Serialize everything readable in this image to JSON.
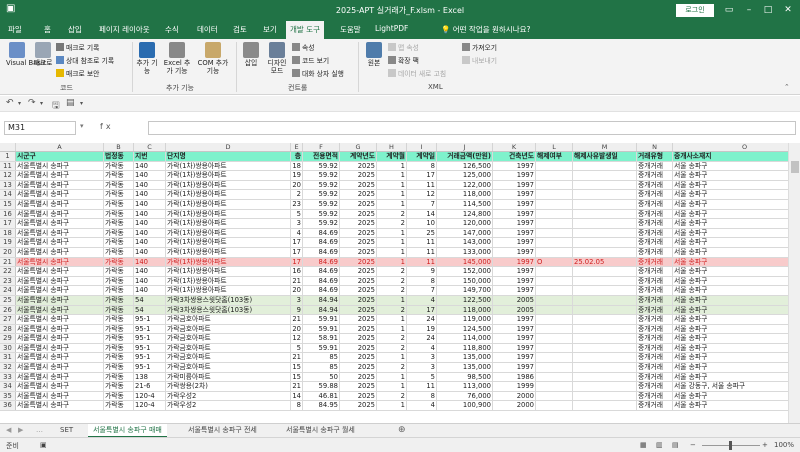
{
  "titlebar": {
    "title": "2025-APT 실거래가_F.xlsm  -  Excel",
    "login": "로그인"
  },
  "ribbon_tabs": [
    "파일",
    "홈",
    "삽입",
    "페이지 레이아웃",
    "수식",
    "데이터",
    "검토",
    "보기",
    "개발 도구",
    "도움말",
    "LightPDF"
  ],
  "active_tab": "개발 도구",
  "tell_me": "어떤 작업을 원하시나요?",
  "ribbon": {
    "code_group": "코드",
    "vb_label": "Visual Basic",
    "macro_label": "매크로",
    "record_macro": "매크로 기록",
    "relative_ref": "상대 참조로 기록",
    "macro_security": "매크로 보안",
    "addins_group": "추가 기능",
    "addins": "추가 기능",
    "excel_addins": "Excel 추가 기능",
    "com_addins": "COM 추가 기능",
    "controls_group": "컨트롤",
    "insert": "삽입",
    "design_mode": "디자인 모드",
    "properties": "속성",
    "view_code": "코드 보기",
    "run_dialog": "대화 상자 실행",
    "xml_group": "XML",
    "source": "원본",
    "map_properties": "맵 속성",
    "expansion_packs": "확장 팩",
    "refresh_data": "데이터 새로 고침",
    "import": "가져오기",
    "export": "내보내기"
  },
  "name_box": "M31",
  "fx": "fx",
  "columns": [
    {
      "l": "A",
      "w": 88
    },
    {
      "l": "B",
      "w": 30
    },
    {
      "l": "C",
      "w": 32
    },
    {
      "l": "D",
      "w": 125
    },
    {
      "l": "E",
      "w": 12
    },
    {
      "l": "F",
      "w": 37
    },
    {
      "l": "G",
      "w": 37
    },
    {
      "l": "H",
      "w": 30
    },
    {
      "l": "I",
      "w": 30
    },
    {
      "l": "J",
      "w": 56
    },
    {
      "l": "K",
      "w": 43
    },
    {
      "l": "L",
      "w": 37
    },
    {
      "l": "M",
      "w": 64
    },
    {
      "l": "N",
      "w": 36
    },
    {
      "l": "O",
      "w": 144
    }
  ],
  "header_row": [
    "시군구",
    "법정동",
    "지번",
    "단지명",
    "층",
    "전용면적",
    "계약년도",
    "계약월",
    "계약일",
    "거래금액(만원)",
    "건축년도",
    "해제여부",
    "해제사유발생일",
    "거래유형",
    "중개사소재지"
  ],
  "rows": [
    {
      "n": "11",
      "c": [
        "서울특별시 송파구",
        "가락동",
        "140",
        "가락(1차)쌍용아파트",
        "18",
        "59.92",
        "2025",
        "1",
        "8",
        "126,500",
        "1997",
        "",
        "",
        "중개거래",
        "서울 송파구"
      ]
    },
    {
      "n": "12",
      "c": [
        "서울특별시 송파구",
        "가락동",
        "140",
        "가락(1차)쌍용아파트",
        "19",
        "59.92",
        "2025",
        "1",
        "17",
        "125,000",
        "1997",
        "",
        "",
        "중개거래",
        "서울 송파구"
      ]
    },
    {
      "n": "13",
      "c": [
        "서울특별시 송파구",
        "가락동",
        "140",
        "가락(1차)쌍용아파트",
        "20",
        "59.92",
        "2025",
        "1",
        "11",
        "122,000",
        "1997",
        "",
        "",
        "중개거래",
        "서울 송파구"
      ]
    },
    {
      "n": "14",
      "c": [
        "서울특별시 송파구",
        "가락동",
        "140",
        "가락(1차)쌍용아파트",
        "2",
        "59.92",
        "2025",
        "1",
        "12",
        "118,000",
        "1997",
        "",
        "",
        "중개거래",
        "서울 송파구"
      ]
    },
    {
      "n": "15",
      "c": [
        "서울특별시 송파구",
        "가락동",
        "140",
        "가락(1차)쌍용아파트",
        "23",
        "59.92",
        "2025",
        "1",
        "7",
        "114,500",
        "1997",
        "",
        "",
        "중개거래",
        "서울 송파구"
      ]
    },
    {
      "n": "16",
      "c": [
        "서울특별시 송파구",
        "가락동",
        "140",
        "가락(1차)쌍용아파트",
        "5",
        "59.92",
        "2025",
        "2",
        "14",
        "124,800",
        "1997",
        "",
        "",
        "중개거래",
        "서울 송파구"
      ]
    },
    {
      "n": "17",
      "c": [
        "서울특별시 송파구",
        "가락동",
        "140",
        "가락(1차)쌍용아파트",
        "3",
        "59.92",
        "2025",
        "2",
        "10",
        "120,000",
        "1997",
        "",
        "",
        "중개거래",
        "서울 송파구"
      ]
    },
    {
      "n": "18",
      "c": [
        "서울특별시 송파구",
        "가락동",
        "140",
        "가락(1차)쌍용아파트",
        "4",
        "84.69",
        "2025",
        "1",
        "25",
        "147,000",
        "1997",
        "",
        "",
        "중개거래",
        "서울 송파구"
      ]
    },
    {
      "n": "19",
      "c": [
        "서울특별시 송파구",
        "가락동",
        "140",
        "가락(1차)쌍용아파트",
        "17",
        "84.69",
        "2025",
        "1",
        "11",
        "143,000",
        "1997",
        "",
        "",
        "중개거래",
        "서울 송파구"
      ]
    },
    {
      "n": "20",
      "c": [
        "서울특별시 송파구",
        "가락동",
        "140",
        "가락(1차)쌍용아파트",
        "17",
        "84.69",
        "2025",
        "1",
        "11",
        "133,000",
        "1997",
        "",
        "",
        "중개거래",
        "서울 송파구"
      ]
    },
    {
      "n": "21",
      "c": [
        "서울특별시 송파구",
        "가락동",
        "140",
        "가락(1차)쌍용아파트",
        "17",
        "84.69",
        "2025",
        "1",
        "11",
        "145,000",
        "1997",
        "O",
        "25.02.05",
        "중개거래",
        "서울 송파구"
      ],
      "style": "hi"
    },
    {
      "n": "22",
      "c": [
        "서울특별시 송파구",
        "가락동",
        "140",
        "가락(1차)쌍용아파트",
        "16",
        "84.69",
        "2025",
        "2",
        "9",
        "152,000",
        "1997",
        "",
        "",
        "중개거래",
        "서울 송파구"
      ]
    },
    {
      "n": "23",
      "c": [
        "서울특별시 송파구",
        "가락동",
        "140",
        "가락(1차)쌍용아파트",
        "21",
        "84.69",
        "2025",
        "2",
        "8",
        "150,000",
        "1997",
        "",
        "",
        "중개거래",
        "서울 송파구"
      ]
    },
    {
      "n": "24",
      "c": [
        "서울특별시 송파구",
        "가락동",
        "140",
        "가락(1차)쌍용아파트",
        "20",
        "84.69",
        "2025",
        "2",
        "7",
        "149,700",
        "1997",
        "",
        "",
        "중개거래",
        "서울 송파구"
      ]
    },
    {
      "n": "25",
      "c": [
        "서울특별시 송파구",
        "가락동",
        "54",
        "가락3차쌍용스윗닷홈(103동)",
        "3",
        "84.94",
        "2025",
        "1",
        "4",
        "122,500",
        "2005",
        "",
        "",
        "중개거래",
        "서울 송파구"
      ],
      "style": "grn"
    },
    {
      "n": "26",
      "c": [
        "서울특별시 송파구",
        "가락동",
        "54",
        "가락3차쌍용스윗닷홈(103동)",
        "9",
        "84.94",
        "2025",
        "2",
        "17",
        "118,000",
        "2005",
        "",
        "",
        "중개거래",
        "서울 송파구"
      ],
      "style": "grn"
    },
    {
      "n": "27",
      "c": [
        "서울특별시 송파구",
        "가락동",
        "95-1",
        "가락금호아파트",
        "21",
        "59.91",
        "2025",
        "1",
        "24",
        "119,000",
        "1997",
        "",
        "",
        "중개거래",
        "서울 송파구"
      ]
    },
    {
      "n": "28",
      "c": [
        "서울특별시 송파구",
        "가락동",
        "95-1",
        "가락금호아파트",
        "20",
        "59.91",
        "2025",
        "1",
        "19",
        "124,500",
        "1997",
        "",
        "",
        "중개거래",
        "서울 송파구"
      ]
    },
    {
      "n": "29",
      "c": [
        "서울특별시 송파구",
        "가락동",
        "95-1",
        "가락금호아파트",
        "12",
        "58.91",
        "2025",
        "2",
        "24",
        "114,000",
        "1997",
        "",
        "",
        "중개거래",
        "서울 송파구"
      ]
    },
    {
      "n": "30",
      "c": [
        "서울특별시 송파구",
        "가락동",
        "95-1",
        "가락금호아파트",
        "5",
        "59.91",
        "2025",
        "2",
        "4",
        "118,800",
        "1997",
        "",
        "",
        "중개거래",
        "서울 송파구"
      ]
    },
    {
      "n": "31",
      "c": [
        "서울특별시 송파구",
        "가락동",
        "95-1",
        "가락금호아파트",
        "21",
        "85",
        "2025",
        "1",
        "3",
        "135,000",
        "1997",
        "",
        "",
        "중개거래",
        "서울 송파구"
      ]
    },
    {
      "n": "32",
      "c": [
        "서울특별시 송파구",
        "가락동",
        "95-1",
        "가락금호아파트",
        "15",
        "85",
        "2025",
        "2",
        "3",
        "135,000",
        "1997",
        "",
        "",
        "중개거래",
        "서울 송파구"
      ]
    },
    {
      "n": "33",
      "c": [
        "서울특별시 송파구",
        "가락동",
        "138",
        "가락미륭아파트",
        "15",
        "50",
        "2025",
        "1",
        "5",
        "98,500",
        "1986",
        "",
        "",
        "중개거래",
        "서울 송파구"
      ]
    },
    {
      "n": "34",
      "c": [
        "서울특별시 송파구",
        "가락동",
        "21-6",
        "가락쌍용(2차)",
        "21",
        "59.88",
        "2025",
        "1",
        "11",
        "113,000",
        "1999",
        "",
        "",
        "중개거래",
        "서울 강동구, 서울 송파구"
      ]
    },
    {
      "n": "35",
      "c": [
        "서울특별시 송파구",
        "가락동",
        "120-4",
        "가락우성2",
        "14",
        "46.81",
        "2025",
        "2",
        "8",
        "76,000",
        "2000",
        "",
        "",
        "중개거래",
        "서울 송파구"
      ]
    },
    {
      "n": "36",
      "c": [
        "서울특별시 송파구",
        "가락동",
        "120-4",
        "가락우성2",
        "8",
        "84.95",
        "2025",
        "1",
        "4",
        "100,900",
        "2000",
        "",
        "",
        "중개거래",
        "서울 송파구"
      ]
    }
  ],
  "sheet_tabs": [
    "SET",
    "서울특별시 송파구 매매",
    "서울특별시 송파구 전세",
    "서울특별시 송파구 월세"
  ],
  "active_sheet": "서울특별시 송파구 매매",
  "status": {
    "ready": "준비",
    "zoom": "100%"
  },
  "colors": {
    "excel_green": "#217346",
    "header_fill": "#7ef2cc",
    "highlight_fill": "#f8cbcb",
    "highlight_text": "#d02020",
    "green_fill": "#e2efda"
  }
}
